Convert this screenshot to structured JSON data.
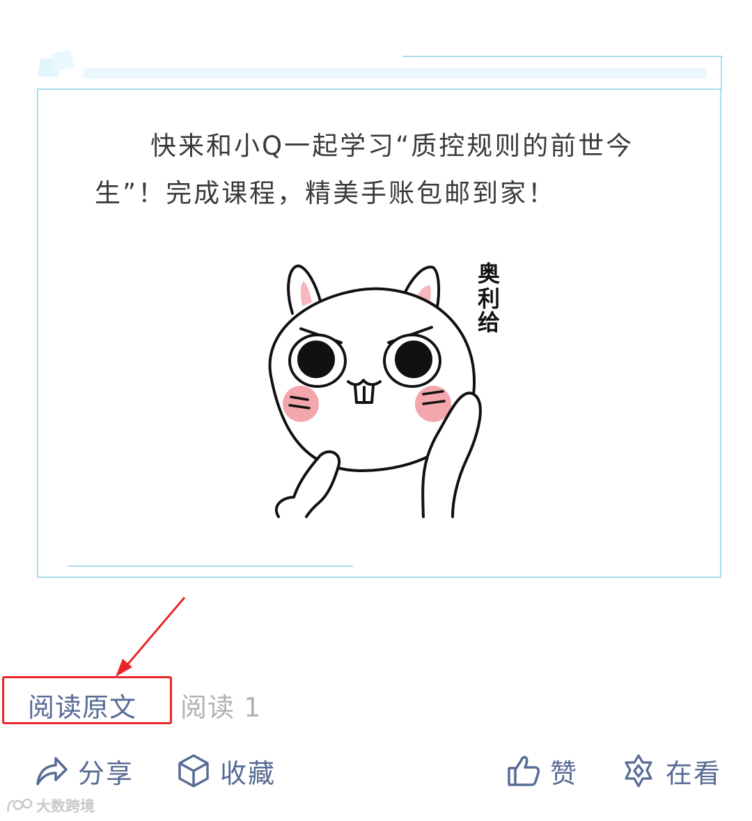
{
  "article": {
    "intro_text": "快来和小Q一起学习“质控规则的前世今生”！完成课程，精美手账包邮到家！",
    "sticker_caption": "奥利给"
  },
  "footer": {
    "read_original_label": "阅读原文",
    "read_count": "阅读 1"
  },
  "actions": {
    "share_label": "分享",
    "favorite_label": "收藏",
    "like_label": "赞",
    "wow_label": "在看"
  },
  "watermark": {
    "text": "大数跨境"
  },
  "colors": {
    "link_blue": "#576b95",
    "frame_blue": "#a9dcee",
    "highlight_red": "#e8262a",
    "muted_gray": "#b2b2b2"
  }
}
